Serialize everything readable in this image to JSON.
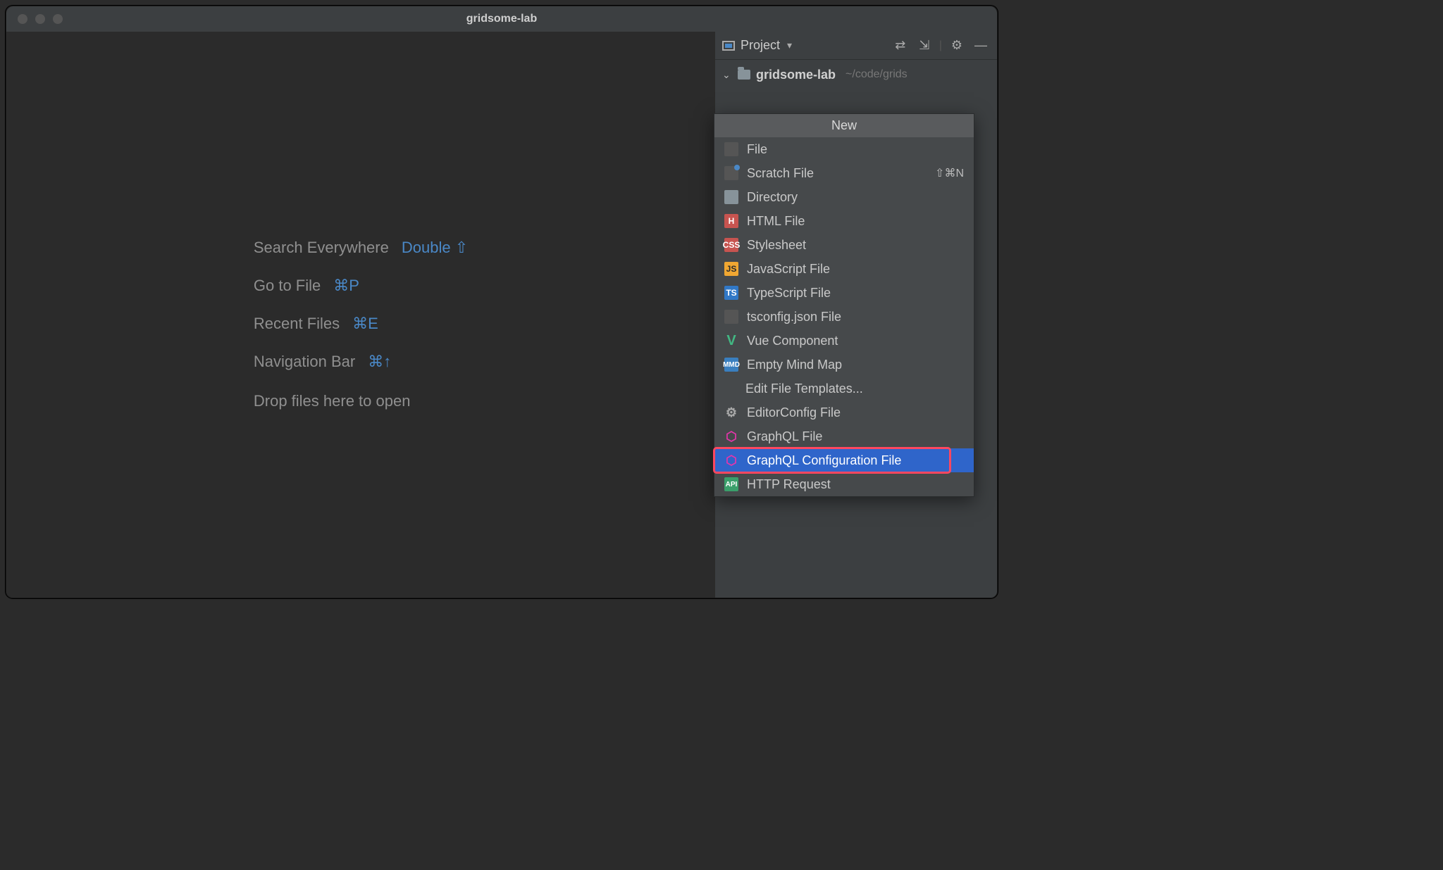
{
  "window": {
    "title": "gridsome-lab"
  },
  "toolwindow": {
    "title": "Project"
  },
  "tree": {
    "root_name": "gridsome-lab",
    "root_path": "~/code/grids"
  },
  "hints": {
    "search_label": "Search Everywhere",
    "search_key": "Double ⇧",
    "goto_label": "Go to File",
    "goto_key": "⌘P",
    "recent_label": "Recent Files",
    "recent_key": "⌘E",
    "nav_label": "Navigation Bar",
    "nav_key": "⌘↑",
    "drop_label": "Drop files here to open"
  },
  "context_menu": {
    "header": "New",
    "items": [
      {
        "id": "file",
        "label": "File",
        "icon": "file"
      },
      {
        "id": "scratch",
        "label": "Scratch File",
        "icon": "scratch",
        "shortcut": "⇧⌘N"
      },
      {
        "id": "directory",
        "label": "Directory",
        "icon": "dir"
      },
      {
        "id": "html",
        "label": "HTML File",
        "icon": "html",
        "badge": "H"
      },
      {
        "id": "css",
        "label": "Stylesheet",
        "icon": "css",
        "badge": "CSS"
      },
      {
        "id": "js",
        "label": "JavaScript File",
        "icon": "js",
        "badge": "JS"
      },
      {
        "id": "ts",
        "label": "TypeScript File",
        "icon": "ts",
        "badge": "TS"
      },
      {
        "id": "tsconfig",
        "label": "tsconfig.json File",
        "icon": "tscfg"
      },
      {
        "id": "vue",
        "label": "Vue Component",
        "icon": "vue",
        "badge": "V"
      },
      {
        "id": "mindmap",
        "label": "Empty Mind Map",
        "icon": "mmd",
        "badge": "MMD"
      },
      {
        "id": "templates",
        "label": "Edit File Templates...",
        "indent": true
      },
      {
        "id": "editorconfig",
        "label": "EditorConfig File",
        "icon": "gear",
        "badge": "⚙"
      },
      {
        "id": "graphql",
        "label": "GraphQL File",
        "icon": "gql",
        "badge": "⬡"
      },
      {
        "id": "graphqlcfg",
        "label": "GraphQL Configuration File",
        "icon": "gql",
        "badge": "⬡",
        "highlight": true
      },
      {
        "id": "http",
        "label": "HTTP Request",
        "icon": "api",
        "badge": "API"
      }
    ]
  }
}
